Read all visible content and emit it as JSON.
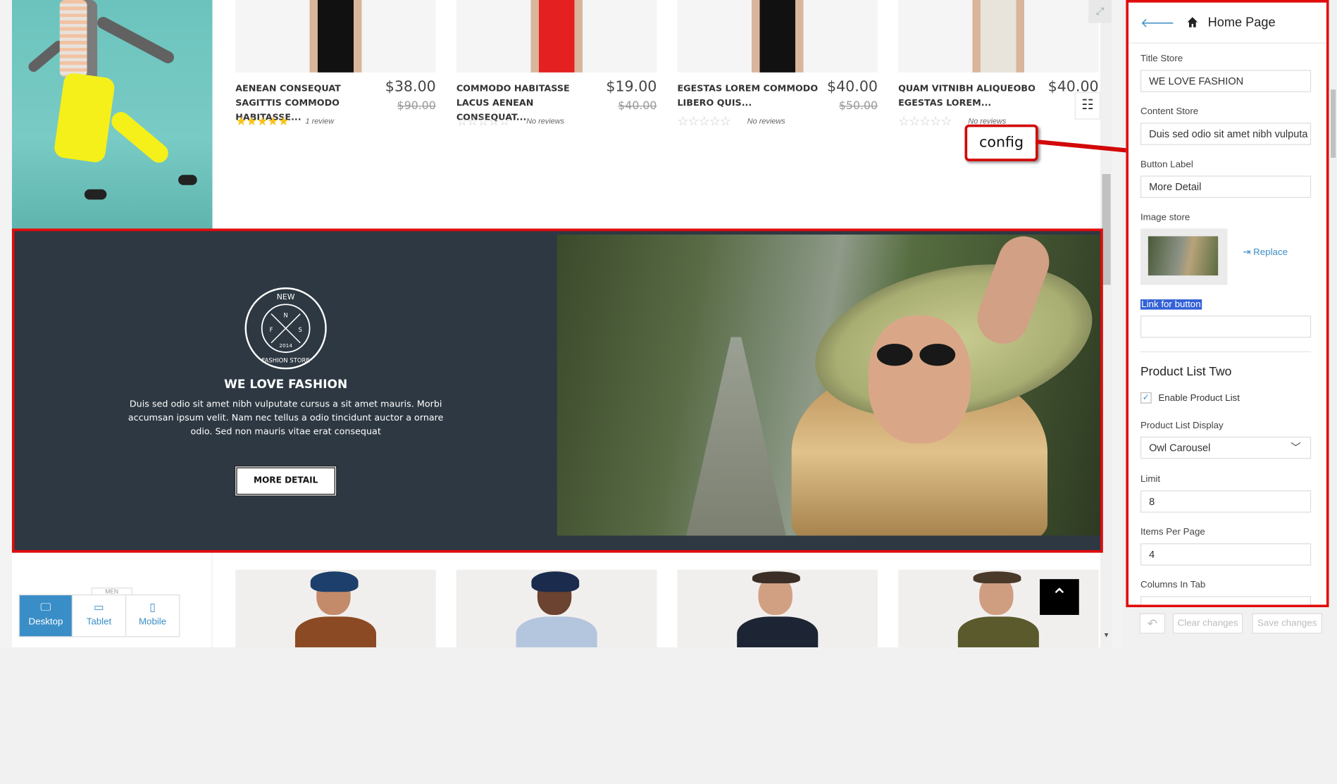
{
  "products_top": [
    {
      "name": "AENEAN CONSEQUAT SAGITTIS COMMODO HABITASSE...",
      "price": "$38.00",
      "old_price": "$90.00",
      "rating": 5,
      "reviews": "1 review",
      "color": "#111111"
    },
    {
      "name": "COMMODO HABITASSE LACUS AENEAN CONSEQUAT...",
      "price": "$19.00",
      "old_price": "$40.00",
      "rating": 0,
      "reviews": "No reviews",
      "color": "#e42020"
    },
    {
      "name": "EGESTAS LOREM COMMODO LIBERO QUIS...",
      "price": "$40.00",
      "old_price": "$50.00",
      "rating": 0,
      "reviews": "No reviews",
      "color": "#111111"
    },
    {
      "name": "QUAM VITNIBH ALIQUEOBO EGESTAS LOREM...",
      "price": "$40.00",
      "old_price": "",
      "rating": 0,
      "reviews": "No reviews",
      "color": "#e8e4dc"
    }
  ],
  "banner": {
    "logo": {
      "top": "NEW",
      "letters": [
        "N",
        "F",
        "S"
      ],
      "year": "2014",
      "bottom": "FASHION STORE"
    },
    "title": "WE LOVE FASHION",
    "content": "Duis sed odio sit amet nibh vulputate cursus a sit amet mauris. Morbi accumsan ipsum velit. Nam nec tellus a odio tincidunt auctor a ornare odio. Sed non mauris vitae erat consequat",
    "button": "MORE DETAIL"
  },
  "annotation": {
    "label": "config"
  },
  "menu_tag": "MEN",
  "devices": [
    {
      "label": "Desktop",
      "icon": "desktop-icon",
      "active": true
    },
    {
      "label": "Tablet",
      "icon": "tablet-icon",
      "active": false
    },
    {
      "label": "Mobile",
      "icon": "mobile-icon",
      "active": false
    }
  ],
  "panel": {
    "title": "Home Page",
    "title_store_label": "Title Store",
    "title_store_value": "WE LOVE FASHION",
    "content_store_label": "Content Store",
    "content_store_value": "Duis sed odio sit amet nibh vulputa",
    "button_label_label": "Button Label",
    "button_label_value": "More Detail",
    "image_store_label": "Image store",
    "replace_label": "Replace",
    "link_label": "Link for button",
    "link_value": "",
    "section_title": "Product List Two",
    "enable_label": "Enable Product List",
    "enable_checked": true,
    "display_label": "Product List Display",
    "display_value": "Owl Carousel",
    "limit_label": "Limit",
    "limit_value": "8",
    "items_label": "Items Per Page",
    "items_value": "4",
    "columns_label": "Columns In Tab"
  },
  "footer": {
    "clear": "Clear changes",
    "save": "Save changes"
  },
  "colors": {
    "accent": "#3a8ec7",
    "highlight": "#e10b0b",
    "banner_bg": "#2d3842"
  }
}
